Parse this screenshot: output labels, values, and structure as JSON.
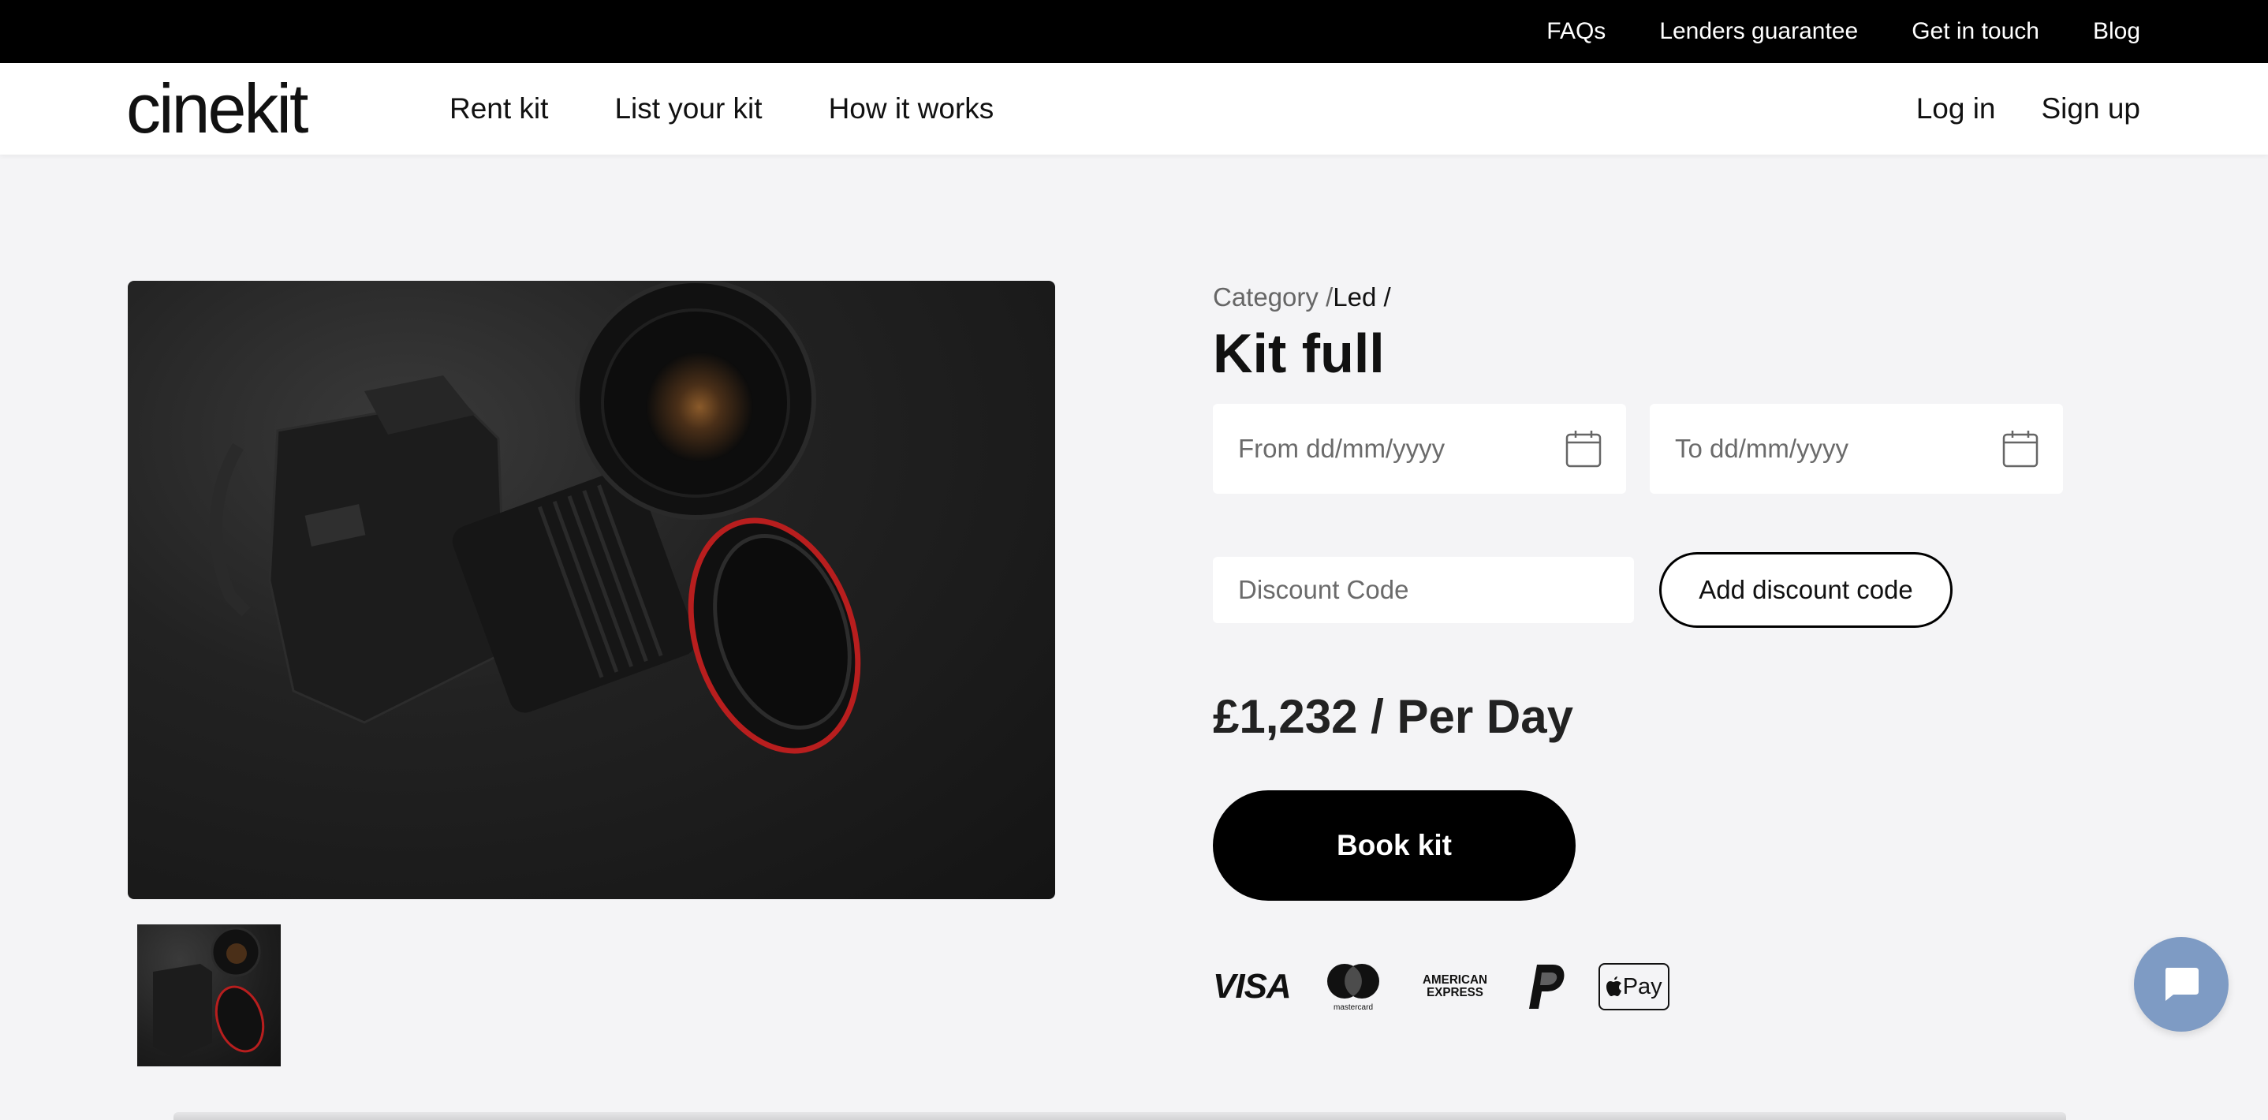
{
  "topbar": {
    "links": [
      "FAQs",
      "Lenders guarantee",
      "Get in touch",
      "Blog"
    ]
  },
  "nav": {
    "logo": "cinekit",
    "links": [
      "Rent kit",
      "List your kit",
      "How it works"
    ],
    "login": "Log in",
    "signup": "Sign up"
  },
  "product": {
    "breadcrumb_prefix": "Category /",
    "breadcrumb_current": "Led /",
    "title": "Kit full",
    "from_placeholder": "From dd/mm/yyyy",
    "to_placeholder": "To dd/mm/yyyy",
    "discount_placeholder": "Discount Code",
    "discount_button": "Add discount code",
    "price": "£1,232 / Per Day",
    "book_button": "Book kit"
  },
  "payments": {
    "visa": "VISA",
    "mastercard": "mastercard",
    "amex_line1": "AMERICAN",
    "amex_line2": "EXPRESS",
    "applepay": "Pay"
  },
  "icons": {
    "calendar": "calendar-icon",
    "chat": "chat-icon"
  }
}
